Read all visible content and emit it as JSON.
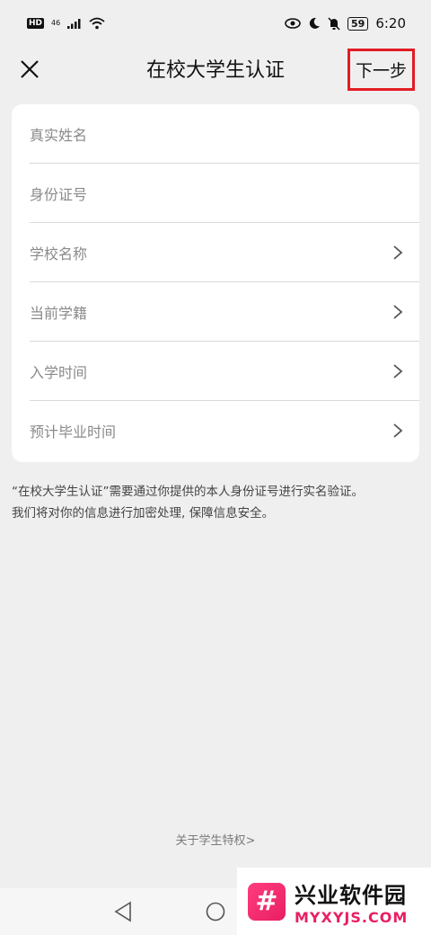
{
  "status_bar": {
    "hd": "HD",
    "signal": "46",
    "battery": "59",
    "time": "6:20",
    "icons": [
      "eye-icon",
      "moon-icon",
      "bell-muted-icon"
    ]
  },
  "header": {
    "title": "在校大学生认证",
    "next_label": "下一步",
    "highlight_color": "#e31b23"
  },
  "form": {
    "rows": [
      {
        "label": "真实姓名",
        "chevron": false
      },
      {
        "label": "身份证号",
        "chevron": false
      },
      {
        "label": "学校名称",
        "chevron": true
      },
      {
        "label": "当前学籍",
        "chevron": true
      },
      {
        "label": "入学时间",
        "chevron": true
      },
      {
        "label": "预计毕业时间",
        "chevron": true
      }
    ]
  },
  "notice": {
    "line1": "“在校大学生认证”需要通过你提供的本人身份证号进行实名验证。",
    "line2": "我们将对你的信息进行加密处理, 保障信息安全。"
  },
  "footer": {
    "privilege_link": "关于学生特权>"
  },
  "watermark": {
    "title": "兴业软件园",
    "url": "MYXYJS.COM",
    "brand_color": "#e91e63"
  }
}
